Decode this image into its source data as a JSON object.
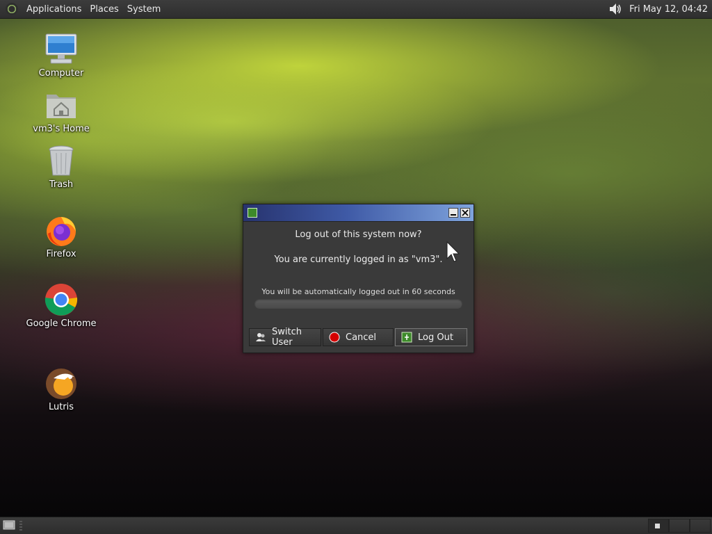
{
  "top_panel": {
    "menus": [
      "Applications",
      "Places",
      "System"
    ],
    "clock": "Fri May 12, 04:42",
    "icons": {
      "logo": "mate-logo-icon",
      "volume": "volume-icon"
    }
  },
  "desktop_icons": [
    {
      "label": "Computer",
      "icon": "computer-icon"
    },
    {
      "label": "vm3's Home",
      "icon": "home-folder-icon"
    },
    {
      "label": "Trash",
      "icon": "trash-icon"
    },
    {
      "label": "Firefox",
      "icon": "firefox-icon"
    },
    {
      "label": "Google Chrome",
      "icon": "chrome-icon"
    },
    {
      "label": "Lutris",
      "icon": "lutris-icon"
    }
  ],
  "dialog": {
    "question": "Log out of this system now?",
    "user_info": "You are currently logged in as \"vm3\".",
    "countdown": "You will be automatically logged out in 60 seconds",
    "progress_fraction": 0,
    "buttons": {
      "switch_user": "Switch User",
      "cancel": "Cancel",
      "log_out": "Log Out"
    }
  },
  "colors": {
    "titlebar_start": "#27336e",
    "titlebar_end": "#7fa4dd",
    "cancel_icon": "#d40000",
    "logout_icon": "#3d8a2a"
  }
}
